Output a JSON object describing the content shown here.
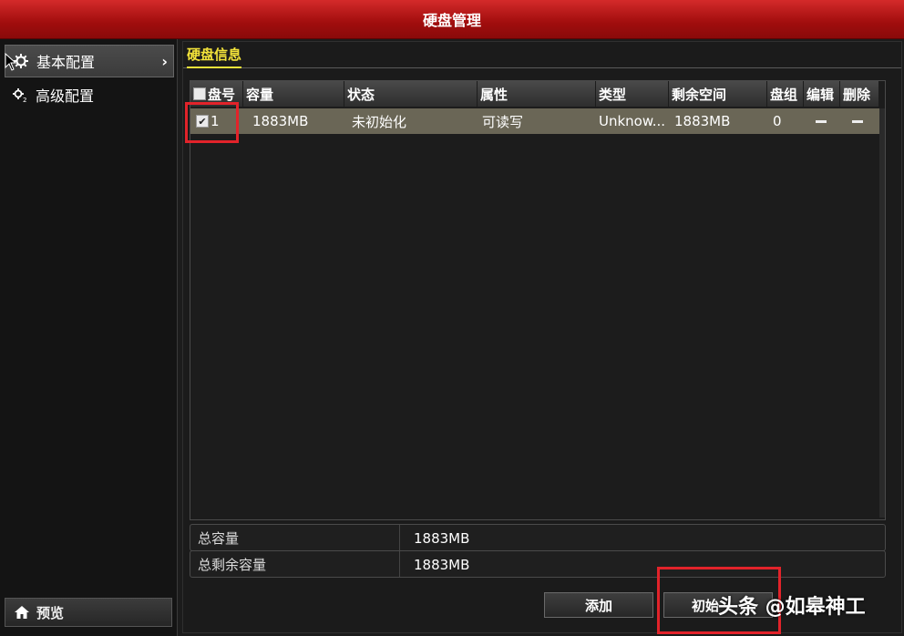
{
  "window": {
    "title": "硬盘管理"
  },
  "sidebar": {
    "items": [
      {
        "label": "基本配置",
        "icon": "gear-icon",
        "active": true
      },
      {
        "label": "高级配置",
        "icon": "gear-advanced-icon",
        "active": false
      }
    ],
    "preview_label": "预览",
    "preview_icon": "home-icon"
  },
  "tabs": [
    {
      "label": "硬盘信息"
    }
  ],
  "table": {
    "columns": [
      "盘号",
      "容量",
      "状态",
      "属性",
      "类型",
      "剩余空间",
      "盘组",
      "编辑",
      "删除"
    ],
    "rows": [
      {
        "checked": true,
        "disk_no": "1",
        "capacity": "1883MB",
        "status": "未初始化",
        "attribute": "可读写",
        "type": "Unknow...",
        "free_space": "1883MB",
        "group": "0"
      }
    ]
  },
  "summary": {
    "total_capacity_label": "总容量",
    "total_capacity_value": "1883MB",
    "total_free_label": "总剩余容量",
    "total_free_value": "1883MB"
  },
  "buttons": {
    "add_label": "添加",
    "init_label": "初始"
  },
  "watermark": "头条 @如皋神工",
  "colors": {
    "title_bar": "#b81414",
    "tab_active": "#f3e33a",
    "highlight_row": "#6a6656",
    "annotation_box": "#e2232a"
  }
}
